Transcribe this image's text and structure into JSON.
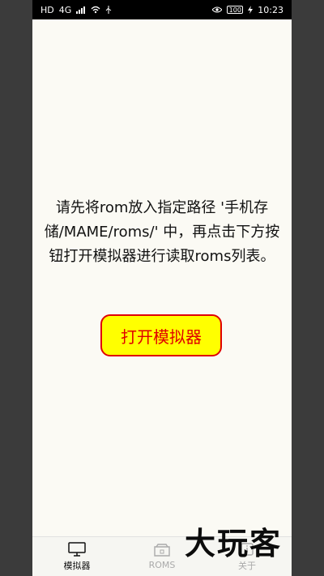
{
  "status_bar": {
    "left_icons": [
      "signal-icon",
      "wifi-icon",
      "usb-icon"
    ],
    "hd_label": "HD",
    "network_label": "4G",
    "eye_icon": "eye-icon",
    "battery": "100",
    "charging_icon": "bolt-icon",
    "time": "10:23"
  },
  "main": {
    "message": "请先将rom放入指定路径 '手机存储/MAME/roms/' 中，再点击下方按钮打开模拟器进行读取roms列表。",
    "open_button": "打开模拟器"
  },
  "tabs": [
    {
      "label": "模拟器",
      "icon": "monitor-icon",
      "active": true
    },
    {
      "label": "ROMS",
      "icon": "folder-icon",
      "active": false
    },
    {
      "label": "关于",
      "icon": "info-icon",
      "active": false
    }
  ],
  "watermark": "大玩客"
}
